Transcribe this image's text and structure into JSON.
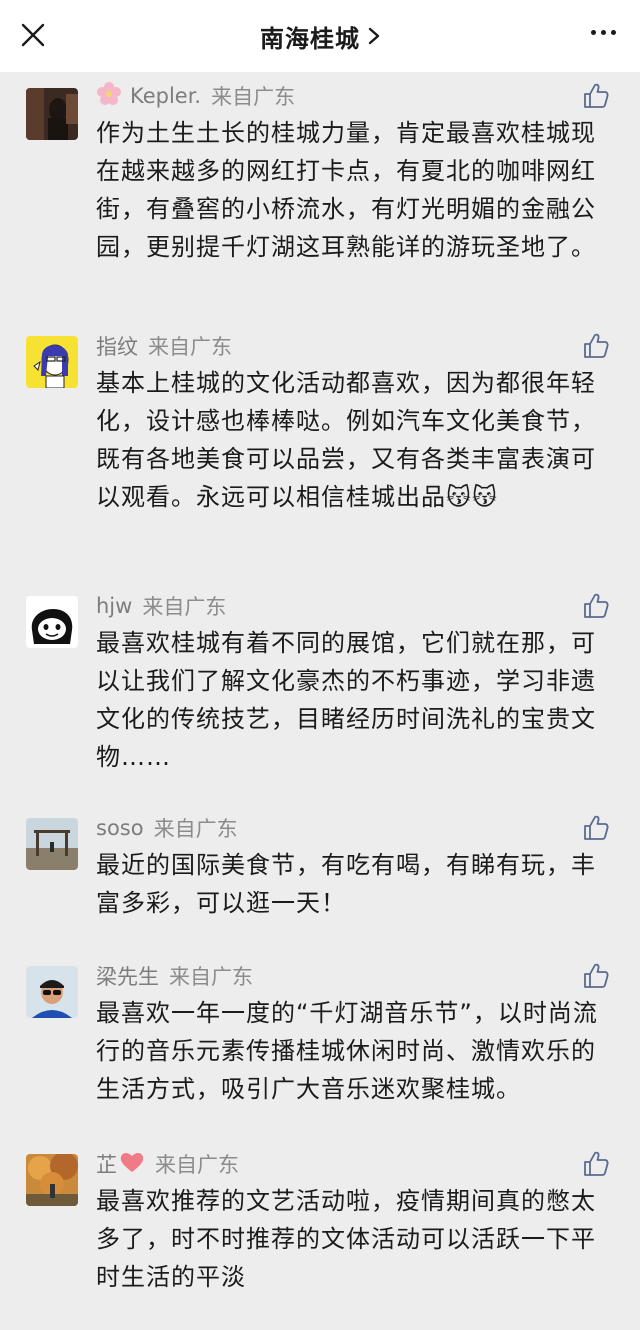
{
  "header": {
    "title": "南海桂城",
    "chevron_icon": "chevron-right-icon",
    "close_icon": "close-icon",
    "more_icon": "more-icon"
  },
  "comments": [
    {
      "name": "Kepler.",
      "name_prefix_icon": "flower",
      "origin": "来自广东",
      "text": "作为土生土长的桂城力量，肯定最喜欢桂城现在越来越多的网红打卡点，有夏北的咖啡网红街，有叠窖的小桥流水，有灯光明媚的金融公园，更别提千灯湖这耳熟能详的游玩圣地了。"
    },
    {
      "name": "指纹",
      "origin": "来自广东",
      "text": "基本上桂城的文化活动都喜欢，因为都很年轻化，设计感也棒棒哒。例如汽车文化美食节，既有各地美食可以品尝，又有各类丰富表演可以观看。永远可以相信桂城出品",
      "emoji": "😽😽"
    },
    {
      "name": "hjw",
      "origin": "来自广东",
      "text": "最喜欢桂城有着不同的展馆，它们就在那，可以让我们了解文化豪杰的不朽事迹，学习非遗文化的传统技艺，目睹经历时间洗礼的宝贵文物……"
    },
    {
      "name": "soso",
      "origin": "来自广东",
      "text": "最近的国际美食节，有吃有喝，有睇有玩，丰富多彩，可以逛一天！"
    },
    {
      "name": "梁先生",
      "origin": "来自广东",
      "text": "最喜欢一年一度的“千灯湖音乐节”，以时尚流行的音乐元素传播桂城休闲时尚、激情欢乐的生活方式，吸引广大音乐迷欢聚桂城。"
    },
    {
      "name": "芷",
      "name_suffix_icon": "heart",
      "origin": "来自广东",
      "text": "最喜欢推荐的文艺活动啦，疫情期间真的憋太多了，时不时推荐的文体活动可以活跃一下平时生活的平淡"
    }
  ]
}
